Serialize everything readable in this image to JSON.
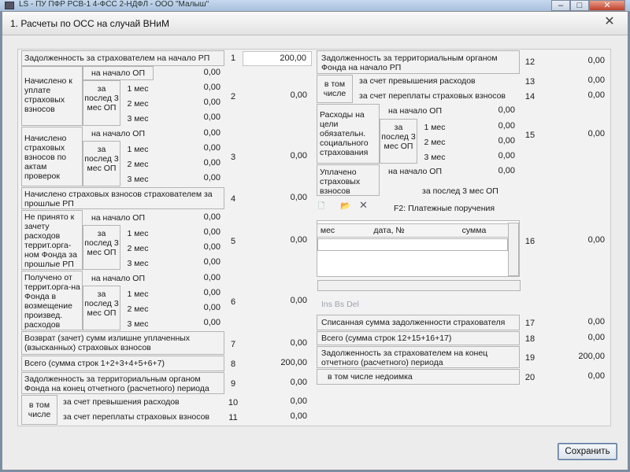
{
  "app": {
    "title": "LS - ПУ ПФР РСВ-1 4-ФСС 2-НДФЛ - ООО \"Малыш\""
  },
  "window_controls": {
    "minimize": "–",
    "maximize": "□",
    "close": "✕"
  },
  "dialog": {
    "title": "1.  Расчеты по ОСС на случай ВНиМ",
    "close": "✕"
  },
  "labels": {
    "zadolzh_nachalo": "Задолженность за страхователем на начало РП",
    "nachisleno_uplate": "Начислено к уплате страховых взносов",
    "na_nachalo_op": "на начало ОП",
    "za_posled": "за послед 3 мес ОП",
    "m1": "1 мес",
    "m2": "2 мес",
    "m3": "3 мес",
    "nachisleno_aktam": "Начислено страховых взносов по актам проверок",
    "nachisleno_proshlye": "Начислено страховых взносов страхователем за прошлые РП",
    "ne_prinyato": "Не принято к зачету расходов террит.орга-ном Фонда за прошлые РП",
    "polucheno": "Получено от террит.орга-на Фонда в возмещение произвед. расходов",
    "vozvrat": "Возврат (зачет) сумм излишне уплаченных (взысканных) страховых взносов",
    "vsego1": "Всего (сумма строк 1+2+3+4+5+6+7)",
    "zadolzh_terr_konec": "Задолженность за территориальным органом Фонда на конец отчетного (расчетного) периода",
    "v_tom_chisle": "в том числе",
    "prevysh": "за счет превышения расходов",
    "pereplata": "за счет переплаты страховых взносов",
    "zadolzh_terr_nachalo": "Задолженность за территориальным органом Фонда на начало РП",
    "rashody": "Расходы на цели обязательн. социального страхования",
    "uplacheno": "Уплачено страховых взносов",
    "za_posled_line": "за послед 3 мес ОП",
    "f2": "F2:  Платежные поручения",
    "col_mes": "мес",
    "col_data": "дата, №",
    "col_summa": "сумма",
    "ins_del": "Ins Bs Del",
    "spisannaya": "Списанная сумма задолженности страхователя",
    "vsego2": "Всего (сумма строк 12+15+16+17)",
    "zadolzh_konec": "Задолженность за страхователем на конец отчетного (расчетного) периода",
    "nedoimka": "в том числе недоимка"
  },
  "rows": {
    "r1": "1",
    "r2": "2",
    "r3": "3",
    "r4": "4",
    "r5": "5",
    "r6": "6",
    "r7": "7",
    "r8": "8",
    "r9": "9",
    "r10": "10",
    "r11": "11",
    "r12": "12",
    "r13": "13",
    "r14": "14",
    "r15": "15",
    "r16": "16",
    "r17": "17",
    "r18": "18",
    "r19": "19",
    "r20": "20"
  },
  "values": {
    "v1": "200,00",
    "v2": "0,00",
    "v2_nach": "0,00",
    "v2_m1": "0,00",
    "v2_m2": "0,00",
    "v2_m3": "0,00",
    "v3": "0,00",
    "v3_nach": "0,00",
    "v3_m1": "0,00",
    "v3_m2": "0,00",
    "v3_m3": "0,00",
    "v4": "0,00",
    "v5": "0,00",
    "v5_nach": "0,00",
    "v5_m1": "0,00",
    "v5_m2": "0,00",
    "v5_m3": "0,00",
    "v6": "0,00",
    "v6_nach": "0,00",
    "v6_m1": "0,00",
    "v6_m2": "0,00",
    "v6_m3": "0,00",
    "v7": "0,00",
    "v8": "200,00",
    "v9": "0,00",
    "v10": "0,00",
    "v11": "0,00",
    "v12": "0,00",
    "v13": "0,00",
    "v14": "0,00",
    "v15": "0,00",
    "v15_nach": "0,00",
    "v15_m1": "0,00",
    "v15_m2": "0,00",
    "v15_m3": "0,00",
    "v16_nach": "0,00",
    "v16": "0,00",
    "v17": "0,00",
    "v18": "0,00",
    "v19": "200,00",
    "v20": "0,00"
  },
  "buttons": {
    "save": "Сохранить"
  }
}
